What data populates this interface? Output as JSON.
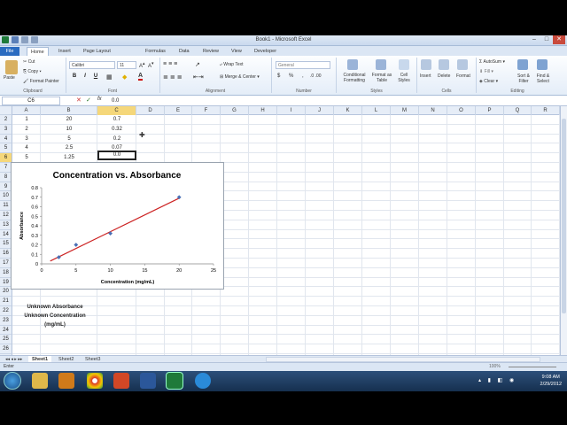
{
  "window": {
    "title": "Book1 - Microsoft Excel"
  },
  "ribbon_tabs": [
    "File",
    "Home",
    "Insert",
    "Page Layout",
    "Formulas",
    "Data",
    "Review",
    "View",
    "Developer"
  ],
  "ribbon": {
    "paste": "Paste",
    "cut": "Cut",
    "copy": "Copy",
    "format_painter": "Format Painter",
    "font_name": "Calibri",
    "font_size": "11",
    "wrap_text": "Wrap Text",
    "merge_center": "Merge & Center",
    "number_format": "General",
    "conditional_formatting": "Conditional Formatting",
    "format_as_table": "Format as Table",
    "cell_styles": "Cell Styles",
    "insert": "Insert",
    "delete": "Delete",
    "format": "Format",
    "autosum": "AutoSum",
    "fill": "Fill",
    "clear": "Clear",
    "sort_filter": "Sort & Filter",
    "find_select": "Find & Select",
    "groups": {
      "clipboard": "Clipboard",
      "font": "Font",
      "alignment": "Alignment",
      "number": "Number",
      "styles": "Styles",
      "cells": "Cells",
      "editing": "Editing"
    }
  },
  "formula_bar": {
    "name_box": "C6",
    "fx": "fx",
    "value": "0.0"
  },
  "columns": [
    "A",
    "B",
    "C",
    "D",
    "E",
    "F",
    "G",
    "H",
    "I",
    "J",
    "K",
    "L",
    "M",
    "N",
    "O",
    "P",
    "Q",
    "R"
  ],
  "rows": [
    "2",
    "3",
    "4",
    "5",
    "6",
    "7",
    "8",
    "9",
    "10",
    "11",
    "12",
    "13",
    "14",
    "15",
    "16",
    "17",
    "18",
    "19",
    "20",
    "21",
    "22",
    "23",
    "24",
    "25",
    "26",
    "27"
  ],
  "table": [
    [
      "1",
      "20",
      "0.7"
    ],
    [
      "2",
      "10",
      "0.32"
    ],
    [
      "3",
      "5",
      "0.2"
    ],
    [
      "4",
      "2.5",
      "0.07"
    ],
    [
      "5",
      "1.25",
      "0.0"
    ]
  ],
  "notes": {
    "unknown_absorbance": "Unknown Absorbance",
    "unknown_concentration": "Unknown Concentration",
    "unit": "(mg/mL)"
  },
  "chart_data": {
    "type": "scatter",
    "title": "Concentration vs. Absorbance",
    "xlabel": "Concentration (mg/mL)",
    "ylabel": "Absorbance",
    "x": [
      2.5,
      5,
      10,
      20
    ],
    "y": [
      0.07,
      0.2,
      0.32,
      0.7
    ],
    "xlim": [
      0,
      25
    ],
    "ylim": [
      0,
      0.8
    ],
    "xticks": [
      "0",
      "5",
      "10",
      "15",
      "20",
      "25"
    ],
    "yticks": [
      "0",
      "0.1",
      "0.2",
      "0.3",
      "0.4",
      "0.5",
      "0.6",
      "0.7",
      "0.8"
    ],
    "trendline": {
      "x": [
        1.25,
        20
      ],
      "y": [
        0.03,
        0.69
      ],
      "color": "#cc2222"
    },
    "marker_color": "#4a6fb5"
  },
  "sheet_tabs": [
    "Sheet1",
    "Sheet2",
    "Sheet3"
  ],
  "status": {
    "mode": "Enter",
    "zoom": "100%"
  },
  "taskbar": {
    "time": "9:08 AM",
    "date": "2/29/2012"
  }
}
